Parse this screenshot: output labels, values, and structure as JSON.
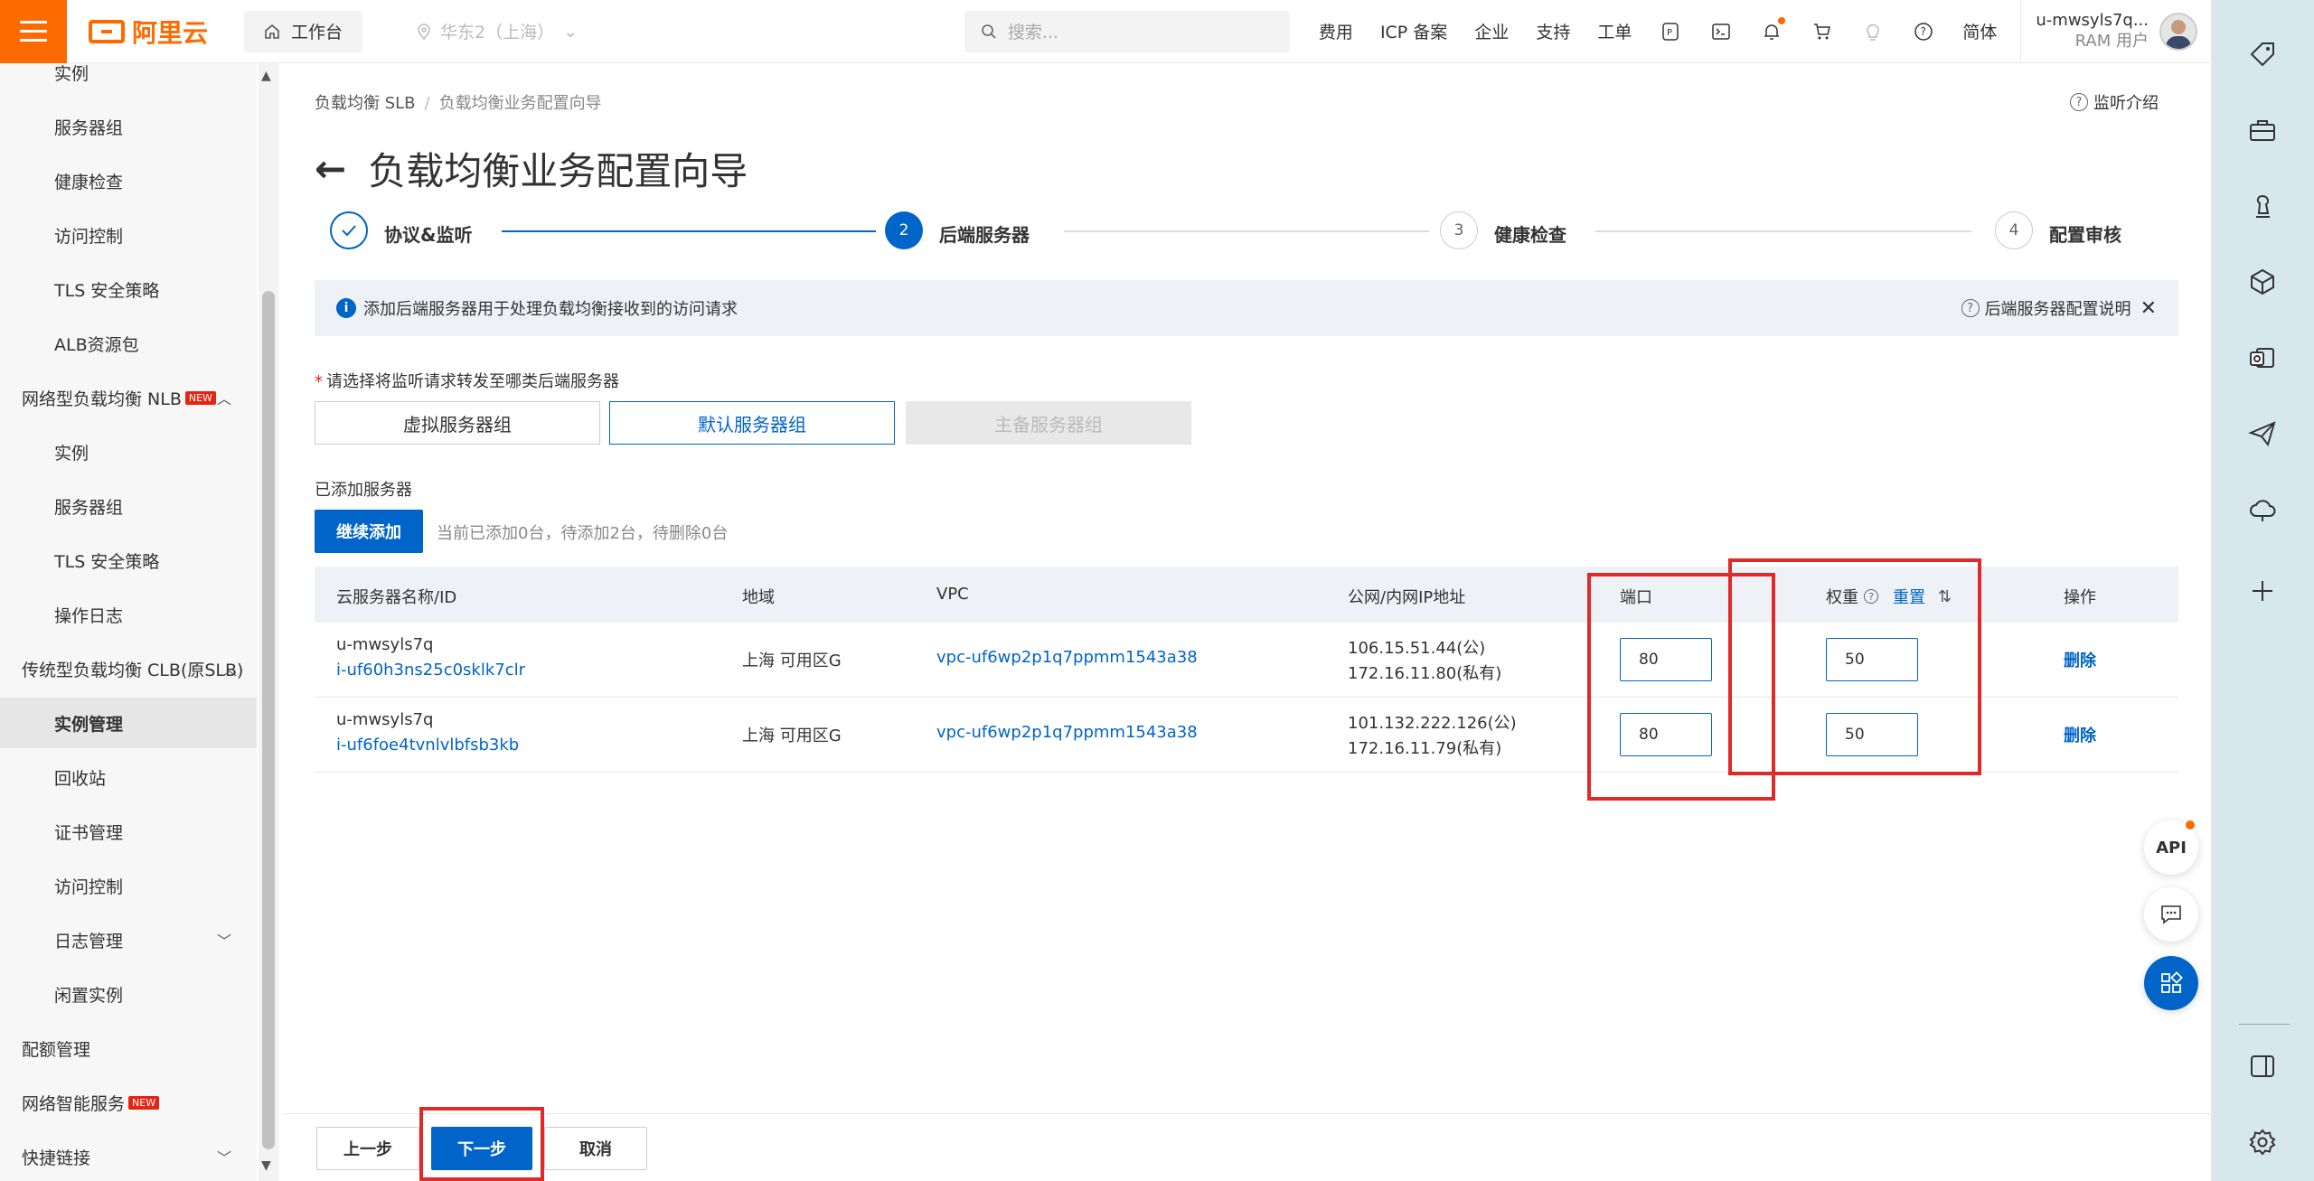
{
  "topbar": {
    "logo": "阿里云",
    "workbench": "工作台",
    "region": "华东2（上海）",
    "search_placeholder": "搜索...",
    "nav": [
      "费用",
      "ICP 备案",
      "企业",
      "支持",
      "工单"
    ],
    "language": "简体",
    "user_name": "u-mwsyls7q...",
    "user_role": "RAM 用户"
  },
  "sidebar": {
    "items": [
      {
        "label": "实例",
        "level": "sub"
      },
      {
        "label": "服务器组",
        "level": "sub"
      },
      {
        "label": "健康检查",
        "level": "sub"
      },
      {
        "label": "访问控制",
        "level": "sub"
      },
      {
        "label": "TLS 安全策略",
        "level": "sub"
      },
      {
        "label": "ALB资源包",
        "level": "sub"
      },
      {
        "label": "网络型负载均衡 NLB",
        "level": "top",
        "badge": "NEW"
      },
      {
        "label": "实例",
        "level": "sub"
      },
      {
        "label": "服务器组",
        "level": "sub"
      },
      {
        "label": "TLS 安全策略",
        "level": "sub"
      },
      {
        "label": "操作日志",
        "level": "sub"
      },
      {
        "label": "传统型负载均衡 CLB(原SLB)",
        "level": "top"
      },
      {
        "label": "实例管理",
        "level": "sub",
        "active": true
      },
      {
        "label": "回收站",
        "level": "sub"
      },
      {
        "label": "证书管理",
        "level": "sub"
      },
      {
        "label": "访问控制",
        "level": "sub"
      },
      {
        "label": "日志管理",
        "level": "sub"
      },
      {
        "label": "闲置实例",
        "level": "sub"
      },
      {
        "label": "配额管理",
        "level": "top"
      },
      {
        "label": "网络智能服务",
        "level": "top",
        "badge": "NEW"
      },
      {
        "label": "快捷链接",
        "level": "top"
      }
    ]
  },
  "breadcrumb": [
    "负载均衡 SLB",
    "负载均衡业务配置向导"
  ],
  "help_link": "监听介绍",
  "page_title": "负载均衡业务配置向导",
  "steps": [
    {
      "num": "",
      "label": "协议&监听",
      "state": "done"
    },
    {
      "num": "2",
      "label": "后端服务器",
      "state": "active"
    },
    {
      "num": "3",
      "label": "健康检查",
      "state": "todo"
    },
    {
      "num": "4",
      "label": "配置审核",
      "state": "todo"
    }
  ],
  "info_bar": {
    "text": "添加后端服务器用于处理负载均衡接收到的访问请求",
    "link": "后端服务器配置说明"
  },
  "server_group": {
    "prompt": "请选择将监听请求转发至哪类后端服务器",
    "options": [
      "虚拟服务器组",
      "默认服务器组",
      "主备服务器组"
    ],
    "selected": "默认服务器组",
    "disabled": "主备服务器组"
  },
  "added": {
    "label": "已添加服务器",
    "add_button": "继续添加",
    "status": "当前已添加0台，待添加2台，待删除0台"
  },
  "table": {
    "columns": [
      "云服务器名称/ID",
      "地域",
      "VPC",
      "公网/内网IP地址",
      "端口",
      "权重",
      "重置",
      "操作"
    ],
    "rows": [
      {
        "name": "u-mwsyls7q",
        "id": "i-uf60h3ns25c0sklk7clr",
        "region": "上海 可用区G",
        "vpc": "vpc-uf6wp2p1q7ppmm1543a38",
        "public_ip": "106.15.51.44(公)",
        "private_ip": "172.16.11.80(私有)",
        "port": "80",
        "weight": "50",
        "action": "删除"
      },
      {
        "name": "u-mwsyls7q",
        "id": "i-uf6foe4tvnlvlbfsb3kb",
        "region": "上海 可用区G",
        "vpc": "vpc-uf6wp2p1q7ppmm1543a38",
        "public_ip": "101.132.222.126(公)",
        "private_ip": "172.16.11.79(私有)",
        "port": "80",
        "weight": "50",
        "action": "删除"
      }
    ]
  },
  "footer": {
    "prev": "上一步",
    "next": "下一步",
    "cancel": "取消"
  },
  "float": {
    "api": "API"
  },
  "colors": {
    "brand": "#ff6a00",
    "primary": "#0064c8",
    "highlight": "#e02a2a"
  }
}
